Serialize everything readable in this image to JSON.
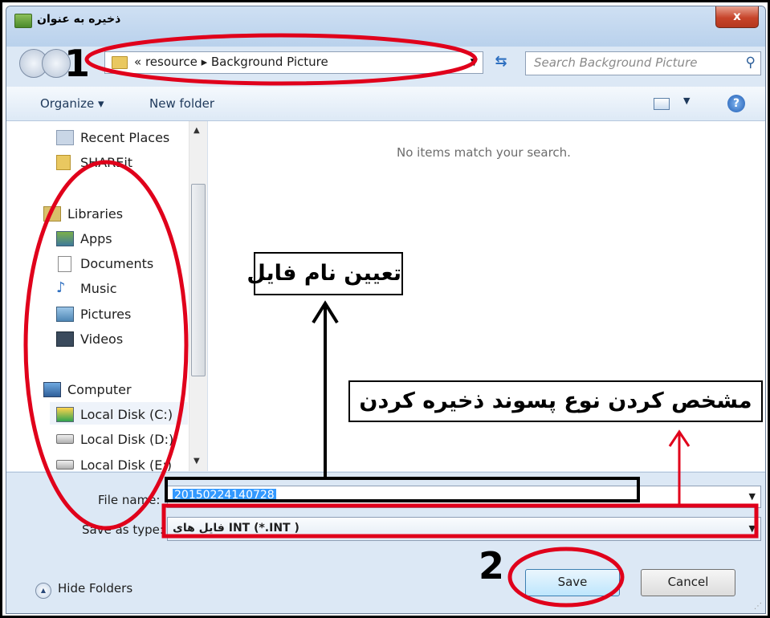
{
  "window": {
    "title": "ذخیره به عنوان",
    "close_label": "x"
  },
  "address": {
    "path": "« resource ▸ Background Picture",
    "search_placeholder": "Search Background Picture"
  },
  "toolbar": {
    "organize_label": "Organize ▾",
    "new_folder_label": "New folder",
    "help_label": "?"
  },
  "nav": {
    "items": [
      {
        "label": "Recent Places",
        "icon": "recent-places-icon"
      },
      {
        "label": "SHAREit",
        "icon": "folder-icon"
      },
      {
        "label": "Libraries",
        "icon": "libraries-icon"
      },
      {
        "label": "Apps",
        "icon": "apps-icon"
      },
      {
        "label": "Documents",
        "icon": "documents-icon"
      },
      {
        "label": "Music",
        "icon": "music-icon"
      },
      {
        "label": "Pictures",
        "icon": "pictures-icon"
      },
      {
        "label": "Videos",
        "icon": "videos-icon"
      },
      {
        "label": "Computer",
        "icon": "computer-icon"
      },
      {
        "label": "Local Disk (C:)",
        "icon": "system-disk-icon"
      },
      {
        "label": "Local Disk (D:)",
        "icon": "disk-icon"
      },
      {
        "label": "Local Disk (E:)",
        "icon": "disk-icon"
      }
    ]
  },
  "content": {
    "empty_message": "No items match your search."
  },
  "form": {
    "file_name_label": "File name:",
    "file_name_value": "20150224140728",
    "save_type_label": "Save as type:",
    "save_type_value": "فایل های INT (*.INT )"
  },
  "footer": {
    "hide_folders_label": "Hide Folders",
    "save_label": "Save",
    "cancel_label": "Cancel"
  },
  "annotations": {
    "file_name_note": "تعیین نام فایل",
    "file_type_note": "مشخص کردن نوع پسوند ذخیره کردن",
    "step1": "1",
    "step2": "2"
  },
  "colors": {
    "highlight_red": "#e0001b",
    "selection_blue": "#3399ff",
    "window_frame": "#dce8f5"
  }
}
